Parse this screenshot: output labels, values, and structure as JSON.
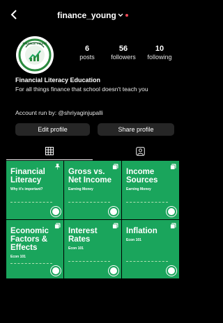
{
  "header": {
    "username": "finance_young",
    "chevron": "⌄",
    "back_icon": "chevron-left-icon",
    "notification_color": "#ed4956"
  },
  "profile": {
    "avatar_text": "FINANCE YOUNG",
    "stats": [
      {
        "value": "6",
        "label": "posts"
      },
      {
        "value": "56",
        "label": "followers"
      },
      {
        "value": "10",
        "label": "following"
      }
    ],
    "name": "Financial Literacy Education",
    "bio": "For all things finance that school doesn't teach you",
    "account_run_by": "Account run by: @shriyaginjupalli"
  },
  "actions": {
    "edit_profile": "Edit profile",
    "share_profile": "Share profile"
  },
  "tabs": [
    "grid-icon",
    "tagged-icon"
  ],
  "posts": [
    {
      "title": "Financial Literacy",
      "subtitle": "Why it's important?",
      "badge": "pin-icon"
    },
    {
      "title": "Gross vs. Net Income",
      "subtitle": "Earning Money",
      "badge": "carousel-icon"
    },
    {
      "title": "Income Sources",
      "subtitle": "Earning Money",
      "badge": "carousel-icon"
    },
    {
      "title": "Economic Factors & Effects",
      "subtitle": "Econ 101",
      "badge": "carousel-icon"
    },
    {
      "title": "Interest Rates",
      "subtitle": "Econ 101",
      "badge": "carousel-icon"
    },
    {
      "title": "Inflation",
      "subtitle": "Econ 101",
      "badge": "carousel-icon"
    }
  ],
  "colors": {
    "background": "#000000",
    "tile_green": "#1aa55c",
    "button_bg": "#262626"
  }
}
